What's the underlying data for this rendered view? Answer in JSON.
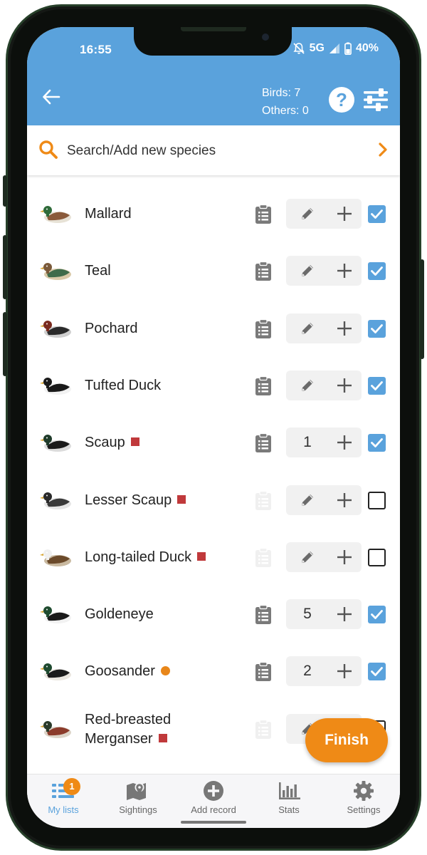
{
  "status_bar": {
    "time": "16:55",
    "network": "5G",
    "battery": "40%"
  },
  "header": {
    "birds_count": "Birds: 7",
    "others_count": "Others: 0",
    "help_label": "?"
  },
  "search": {
    "placeholder": "Search/Add new species"
  },
  "species": [
    {
      "name": "Mallard",
      "marker": "",
      "count": "",
      "checked": true,
      "has_notes": true
    },
    {
      "name": "Teal",
      "marker": "",
      "count": "",
      "checked": true,
      "has_notes": true
    },
    {
      "name": "Pochard",
      "marker": "",
      "count": "",
      "checked": true,
      "has_notes": true
    },
    {
      "name": "Tufted Duck",
      "marker": "",
      "count": "",
      "checked": true,
      "has_notes": true
    },
    {
      "name": "Scaup",
      "marker": "red-square",
      "count": "1",
      "checked": true,
      "has_notes": true
    },
    {
      "name": "Lesser Scaup",
      "marker": "red-square",
      "count": "",
      "checked": false,
      "has_notes": false
    },
    {
      "name": "Long-tailed Duck",
      "marker": "red-square",
      "count": "",
      "checked": false,
      "has_notes": false
    },
    {
      "name": "Goldeneye",
      "marker": "",
      "count": "5",
      "checked": true,
      "has_notes": true
    },
    {
      "name": "Goosander",
      "marker": "orange-dot",
      "count": "2",
      "checked": true,
      "has_notes": true
    },
    {
      "name": "Red-breasted Merganser",
      "marker": "red-square",
      "count": "",
      "checked": false,
      "has_notes": false
    }
  ],
  "finish_button": {
    "label": "Finish"
  },
  "bottom_nav": {
    "items": [
      {
        "label": "My lists",
        "icon": "list-icon",
        "badge": "1",
        "active": true
      },
      {
        "label": "Sightings",
        "icon": "map-icon"
      },
      {
        "label": "Add record",
        "icon": "add-circle-icon"
      },
      {
        "label": "Stats",
        "icon": "bar-chart-icon"
      },
      {
        "label": "Settings",
        "icon": "gear-icon"
      }
    ]
  },
  "colors": {
    "primary": "#5aa2dc",
    "accent": "#ef8a16",
    "rare_marker": "#c0393b"
  }
}
